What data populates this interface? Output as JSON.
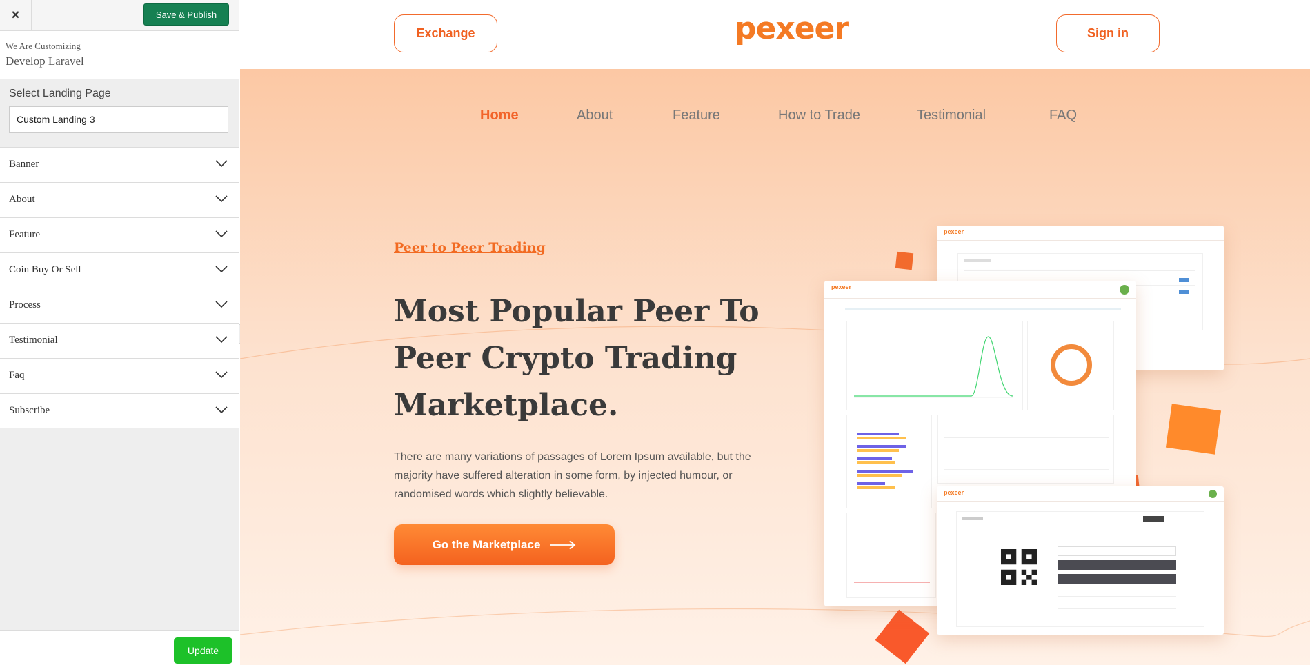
{
  "customizer": {
    "close_icon": "×",
    "save_label": "Save & Publish",
    "customizing_label": "We Are Customizing",
    "site_name": "Develop Laravel",
    "select_label": "Select Landing Page",
    "select_value": "Custom Landing 3",
    "sections": [
      "Banner",
      "About",
      "Feature",
      "Coin Buy Or Sell",
      "Process",
      "Testimonial",
      "Faq",
      "Subscribe"
    ],
    "update_label": "Update"
  },
  "site": {
    "exchange_label": "Exchange",
    "logo_text": "pexeer",
    "signin_label": "Sign in",
    "nav": [
      "Home",
      "About",
      "Feature",
      "How to Trade",
      "Testimonial",
      "FAQ"
    ],
    "active_nav": "Home",
    "hero": {
      "tag": "Peer to Peer Trading",
      "title": "Most Popular Peer To Peer Crypto Trading Marketplace.",
      "description": "There are many variations of passages of Lorem Ipsum available, but the majority have suffered alteration in some form, by injected humour, or randomised words which slightly believable.",
      "cta_label": "Go the Marketplace"
    },
    "mock_logo": "pexeer"
  },
  "colors": {
    "accent": "#f26b2d",
    "save_green": "#168052",
    "update_green": "#1dc129",
    "heading": "#3a3a3a"
  }
}
